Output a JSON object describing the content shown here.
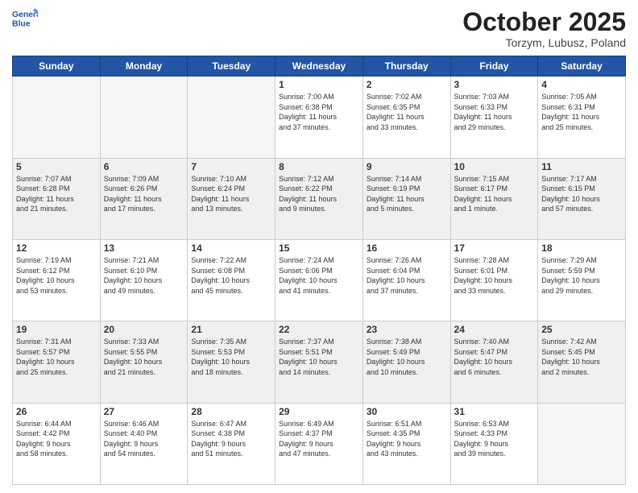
{
  "header": {
    "logo_line1": "General",
    "logo_line2": "Blue",
    "month_title": "October 2025",
    "subtitle": "Torzym, Lubusz, Poland"
  },
  "weekdays": [
    "Sunday",
    "Monday",
    "Tuesday",
    "Wednesday",
    "Thursday",
    "Friday",
    "Saturday"
  ],
  "weeks": [
    [
      {
        "day": "",
        "info": ""
      },
      {
        "day": "",
        "info": ""
      },
      {
        "day": "",
        "info": ""
      },
      {
        "day": "1",
        "info": "Sunrise: 7:00 AM\nSunset: 6:38 PM\nDaylight: 11 hours\nand 37 minutes."
      },
      {
        "day": "2",
        "info": "Sunrise: 7:02 AM\nSunset: 6:35 PM\nDaylight: 11 hours\nand 33 minutes."
      },
      {
        "day": "3",
        "info": "Sunrise: 7:03 AM\nSunset: 6:33 PM\nDaylight: 11 hours\nand 29 minutes."
      },
      {
        "day": "4",
        "info": "Sunrise: 7:05 AM\nSunset: 6:31 PM\nDaylight: 11 hours\nand 25 minutes."
      }
    ],
    [
      {
        "day": "5",
        "info": "Sunrise: 7:07 AM\nSunset: 6:28 PM\nDaylight: 11 hours\nand 21 minutes."
      },
      {
        "day": "6",
        "info": "Sunrise: 7:09 AM\nSunset: 6:26 PM\nDaylight: 11 hours\nand 17 minutes."
      },
      {
        "day": "7",
        "info": "Sunrise: 7:10 AM\nSunset: 6:24 PM\nDaylight: 11 hours\nand 13 minutes."
      },
      {
        "day": "8",
        "info": "Sunrise: 7:12 AM\nSunset: 6:22 PM\nDaylight: 11 hours\nand 9 minutes."
      },
      {
        "day": "9",
        "info": "Sunrise: 7:14 AM\nSunset: 6:19 PM\nDaylight: 11 hours\nand 5 minutes."
      },
      {
        "day": "10",
        "info": "Sunrise: 7:15 AM\nSunset: 6:17 PM\nDaylight: 11 hours\nand 1 minute."
      },
      {
        "day": "11",
        "info": "Sunrise: 7:17 AM\nSunset: 6:15 PM\nDaylight: 10 hours\nand 57 minutes."
      }
    ],
    [
      {
        "day": "12",
        "info": "Sunrise: 7:19 AM\nSunset: 6:12 PM\nDaylight: 10 hours\nand 53 minutes."
      },
      {
        "day": "13",
        "info": "Sunrise: 7:21 AM\nSunset: 6:10 PM\nDaylight: 10 hours\nand 49 minutes."
      },
      {
        "day": "14",
        "info": "Sunrise: 7:22 AM\nSunset: 6:08 PM\nDaylight: 10 hours\nand 45 minutes."
      },
      {
        "day": "15",
        "info": "Sunrise: 7:24 AM\nSunset: 6:06 PM\nDaylight: 10 hours\nand 41 minutes."
      },
      {
        "day": "16",
        "info": "Sunrise: 7:26 AM\nSunset: 6:04 PM\nDaylight: 10 hours\nand 37 minutes."
      },
      {
        "day": "17",
        "info": "Sunrise: 7:28 AM\nSunset: 6:01 PM\nDaylight: 10 hours\nand 33 minutes."
      },
      {
        "day": "18",
        "info": "Sunrise: 7:29 AM\nSunset: 5:59 PM\nDaylight: 10 hours\nand 29 minutes."
      }
    ],
    [
      {
        "day": "19",
        "info": "Sunrise: 7:31 AM\nSunset: 5:57 PM\nDaylight: 10 hours\nand 25 minutes."
      },
      {
        "day": "20",
        "info": "Sunrise: 7:33 AM\nSunset: 5:55 PM\nDaylight: 10 hours\nand 21 minutes."
      },
      {
        "day": "21",
        "info": "Sunrise: 7:35 AM\nSunset: 5:53 PM\nDaylight: 10 hours\nand 18 minutes."
      },
      {
        "day": "22",
        "info": "Sunrise: 7:37 AM\nSunset: 5:51 PM\nDaylight: 10 hours\nand 14 minutes."
      },
      {
        "day": "23",
        "info": "Sunrise: 7:38 AM\nSunset: 5:49 PM\nDaylight: 10 hours\nand 10 minutes."
      },
      {
        "day": "24",
        "info": "Sunrise: 7:40 AM\nSunset: 5:47 PM\nDaylight: 10 hours\nand 6 minutes."
      },
      {
        "day": "25",
        "info": "Sunrise: 7:42 AM\nSunset: 5:45 PM\nDaylight: 10 hours\nand 2 minutes."
      }
    ],
    [
      {
        "day": "26",
        "info": "Sunrise: 6:44 AM\nSunset: 4:42 PM\nDaylight: 9 hours\nand 58 minutes."
      },
      {
        "day": "27",
        "info": "Sunrise: 6:46 AM\nSunset: 4:40 PM\nDaylight: 9 hours\nand 54 minutes."
      },
      {
        "day": "28",
        "info": "Sunrise: 6:47 AM\nSunset: 4:38 PM\nDaylight: 9 hours\nand 51 minutes."
      },
      {
        "day": "29",
        "info": "Sunrise: 6:49 AM\nSunset: 4:37 PM\nDaylight: 9 hours\nand 47 minutes."
      },
      {
        "day": "30",
        "info": "Sunrise: 6:51 AM\nSunset: 4:35 PM\nDaylight: 9 hours\nand 43 minutes."
      },
      {
        "day": "31",
        "info": "Sunrise: 6:53 AM\nSunset: 4:33 PM\nDaylight: 9 hours\nand 39 minutes."
      },
      {
        "day": "",
        "info": ""
      }
    ]
  ]
}
